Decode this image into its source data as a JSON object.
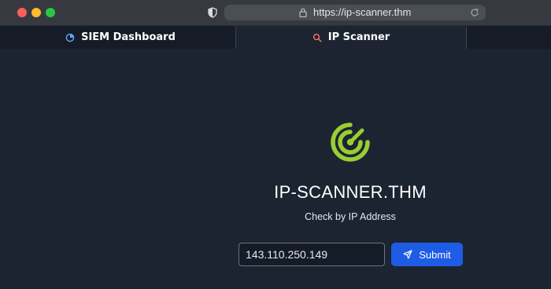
{
  "browser": {
    "url": "https://ip-scanner.thm",
    "icons": {
      "shield": "shield-icon",
      "lock": "lock-icon",
      "reload": "reload-icon"
    }
  },
  "tabs": [
    {
      "label": "SIEM Dashboard",
      "icon": "pie-chart-icon",
      "active": false
    },
    {
      "label": "IP Scanner",
      "icon": "search-icon",
      "active": true
    }
  ],
  "main": {
    "logo_icon": "radar-icon",
    "title": "IP-SCANNER.THM",
    "subtitle": "Check by IP Address",
    "ip_input_value": "143.110.250.149",
    "submit_label": "Submit",
    "submit_icon": "send-icon"
  },
  "colors": {
    "background": "#1c2432",
    "accent_green": "#9acd32",
    "button_blue": "#1e5ce6",
    "tab_icon_blue": "#60a5fa",
    "tab_icon_red": "#f87171"
  }
}
